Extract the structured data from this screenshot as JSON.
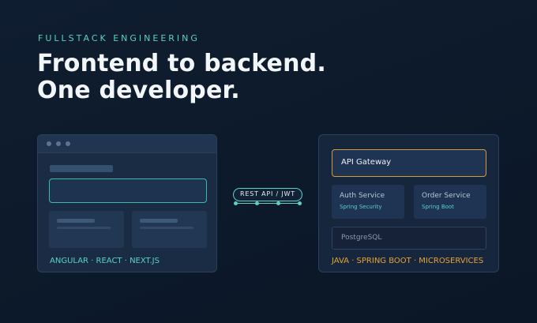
{
  "eyebrow": "FULLSTACK ENGINEERING",
  "headline": {
    "line1": "Frontend to backend.",
    "line2": "One developer."
  },
  "frontend": {
    "stack_label": "ANGULAR · REACT · NEXT.JS"
  },
  "connector": {
    "label": "REST API / JWT"
  },
  "backend": {
    "gateway": "API Gateway",
    "services": [
      {
        "name": "Auth Service",
        "tech": "Spring Security"
      },
      {
        "name": "Order Service",
        "tech": "Spring Boot"
      }
    ],
    "database": "PostgreSQL",
    "stack_label": "JAVA · SPRING BOOT · MICROSERVICES"
  },
  "colors": {
    "background": "#0d1a2b",
    "teal_accent": "#5ad1c6",
    "orange_accent": "#e5a33c",
    "card": "#1a2c44"
  }
}
